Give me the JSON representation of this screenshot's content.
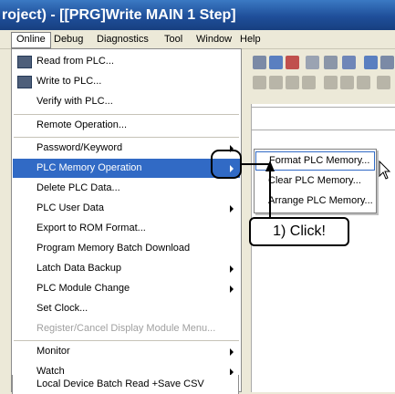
{
  "window": {
    "title": "roject) - [[PRG]Write MAIN 1 Step]"
  },
  "menubar": {
    "items": [
      "Online",
      "Debug",
      "Diagnostics",
      "Tool",
      "Window",
      "Help"
    ]
  },
  "online_menu": {
    "items": [
      {
        "label": "Read from PLC...",
        "has_icon": true,
        "submenu": false
      },
      {
        "label": "Write to PLC...",
        "has_icon": true,
        "submenu": false
      },
      {
        "label": "Verify with PLC...",
        "submenu": false
      },
      {
        "label": "Remote Operation...",
        "submenu": false
      },
      {
        "label": "Password/Keyword",
        "submenu": true
      },
      {
        "label": "PLC Memory Operation",
        "submenu": true,
        "highlighted": true
      },
      {
        "label": "Delete PLC Data...",
        "submenu": false
      },
      {
        "label": "PLC User Data",
        "submenu": true
      },
      {
        "label": "Export to ROM Format...",
        "submenu": false
      },
      {
        "label": "Program Memory Batch Download",
        "submenu": false
      },
      {
        "label": "Latch Data Backup",
        "submenu": true
      },
      {
        "label": "PLC Module Change",
        "submenu": true
      },
      {
        "label": "Set Clock...",
        "submenu": false
      },
      {
        "label": "Register/Cancel Display Module Menu...",
        "disabled": true
      },
      {
        "label": "Monitor",
        "submenu": true
      },
      {
        "label": "Watch",
        "submenu": true
      },
      {
        "label": "Local Device Batch Read +Save CSV",
        "submenu": false
      }
    ]
  },
  "submenu": {
    "items": [
      "Format PLC Memory...",
      "Clear PLC Memory...",
      "Arrange PLC Memory..."
    ]
  },
  "callout": {
    "text": "1) Click!"
  },
  "colors": {
    "highlight": "#316ac5",
    "titlebar": "#1f4f9a",
    "menu_bg": "#ffffff"
  }
}
